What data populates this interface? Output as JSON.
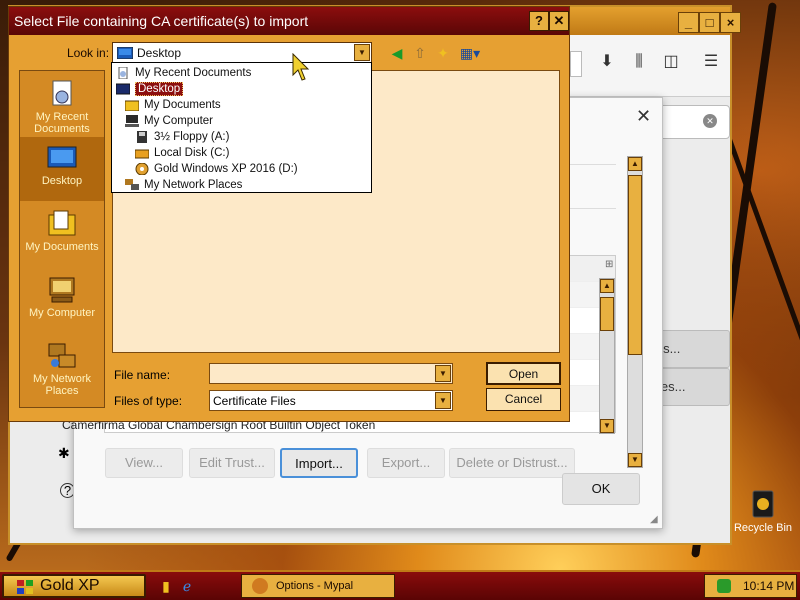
{
  "window": {
    "title": "Select File containing CA certificate(s) to import",
    "help_label": "?",
    "close_label": "✕"
  },
  "lookin": {
    "label": "Look in:",
    "value": "Desktop"
  },
  "dropdown_items": [
    {
      "label": "My Recent Documents",
      "icon": "recent-docs-icon"
    },
    {
      "label": "Desktop",
      "icon": "desktop-icon",
      "highlighted": true
    },
    {
      "label": "My Documents",
      "icon": "my-documents-icon"
    },
    {
      "label": "My Computer",
      "icon": "my-computer-icon"
    },
    {
      "label": "3½ Floppy (A:)",
      "icon": "floppy-icon"
    },
    {
      "label": "Local Disk (C:)",
      "icon": "local-disk-icon"
    },
    {
      "label": "Gold Windows XP 2016 (D:)",
      "icon": "cd-drive-icon"
    },
    {
      "label": "My Network Places",
      "icon": "network-places-icon"
    }
  ],
  "places": [
    {
      "label": "My Recent Documents",
      "icon": "recent-docs-icon"
    },
    {
      "label": "Desktop",
      "icon": "desktop-icon",
      "selected": true
    },
    {
      "label": "My Documents",
      "icon": "my-documents-icon"
    },
    {
      "label": "My Computer",
      "icon": "my-computer-icon"
    },
    {
      "label": "My Network Places",
      "icon": "network-places-icon"
    }
  ],
  "form": {
    "filename_label": "File name:",
    "filename_value": "",
    "filetype_label": "Files of type:",
    "filetype_value": "Certificate Files",
    "open_label": "Open",
    "cancel_label": "Cancel"
  },
  "cert_manager": {
    "last_row_text": "Camerfirma Global Chambersign Root      Builtin Object Token",
    "buttons": {
      "view": "View...",
      "edit_trust": "Edit Trust...",
      "import": "Import...",
      "export": "Export...",
      "delete": "Delete or Distrust..."
    },
    "ok": "OK",
    "close_glyph": "✕"
  },
  "browser": {
    "side_buttons": [
      "ates...",
      "vices..."
    ]
  },
  "desktop": {
    "recycle_bin": "Recycle Bin"
  },
  "taskbar": {
    "start_label": "Gold XP",
    "task_label": "Options - Mypal",
    "clock": "10:14 PM"
  },
  "colors": {
    "titlebar": "#8c0e0e",
    "dialog_bg": "#e6a032",
    "highlight": "#8c0e0e",
    "taskbar": "#7a0808"
  }
}
